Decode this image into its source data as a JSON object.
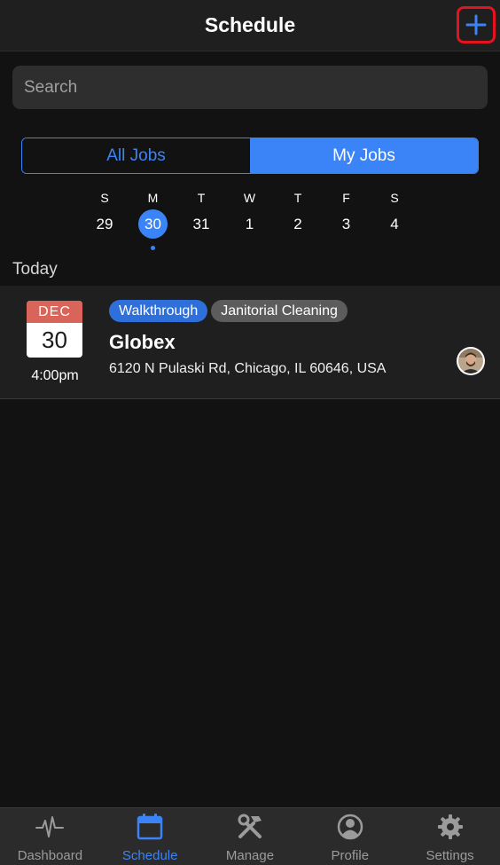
{
  "header": {
    "title": "Schedule",
    "add_icon": "plus-icon"
  },
  "search": {
    "placeholder": "Search",
    "value": ""
  },
  "segments": {
    "all_jobs": "All Jobs",
    "my_jobs": "My Jobs",
    "selected": "My Jobs"
  },
  "week": {
    "days": [
      {
        "letter": "S",
        "number": "29"
      },
      {
        "letter": "M",
        "number": "30"
      },
      {
        "letter": "T",
        "number": "31"
      },
      {
        "letter": "W",
        "number": "1"
      },
      {
        "letter": "T",
        "number": "2"
      },
      {
        "letter": "F",
        "number": "3"
      },
      {
        "letter": "S",
        "number": "4"
      }
    ],
    "selected_index": 1
  },
  "section_title": "Today",
  "job": {
    "month": "DEC",
    "day": "30",
    "time": "4:00pm",
    "tags": [
      "Walkthrough",
      "Janitorial Cleaning"
    ],
    "title": "Globex",
    "address": "6120 N Pulaski Rd, Chicago, IL 60646, USA"
  },
  "tabbar": {
    "items": [
      {
        "label": "Dashboard",
        "icon": "pulse-icon"
      },
      {
        "label": "Schedule",
        "icon": "calendar-icon"
      },
      {
        "label": "Manage",
        "icon": "tools-icon"
      },
      {
        "label": "Profile",
        "icon": "person-icon"
      },
      {
        "label": "Settings",
        "icon": "gear-icon"
      }
    ],
    "active": "Schedule"
  },
  "colors": {
    "accent": "#3b84f7",
    "highlight_border": "#e3141d",
    "background": "#121212",
    "card": "#1f1f1f",
    "calendar_red": "#d96459",
    "tag_gray": "#5c5c5c"
  }
}
